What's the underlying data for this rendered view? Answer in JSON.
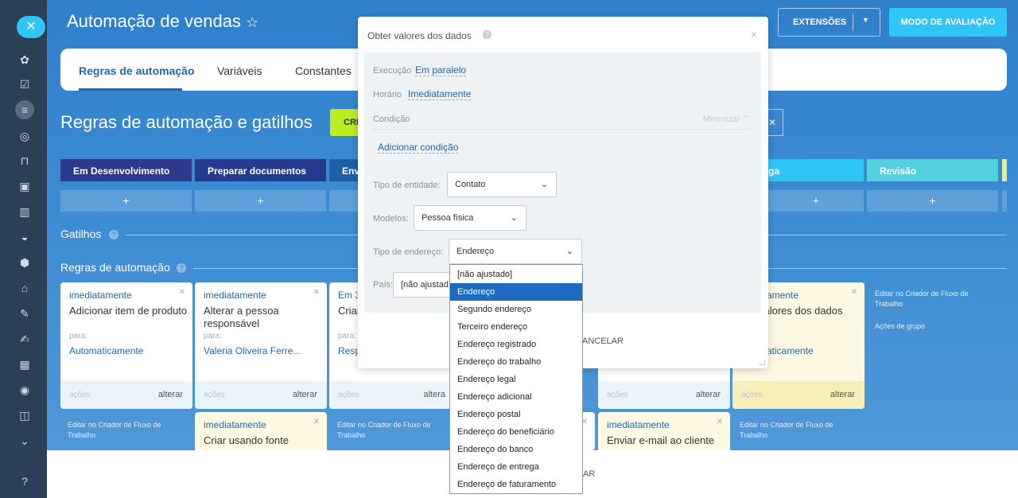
{
  "page": {
    "title": "Automação de vendas",
    "extensions_label": "EXTENSÕES",
    "mode_label": "MODO DE AVALIAÇÃO"
  },
  "tabs": [
    "Regras de automação",
    "Variáveis",
    "Constantes"
  ],
  "section_title": "Regras de automação e gatilhos",
  "create_label": "CRI",
  "stages": [
    {
      "label": "Em Desenvolvimento",
      "color": "#2c3a8c"
    },
    {
      "label": "Preparar documentos",
      "color": "#253b8e"
    },
    {
      "label": "Envi",
      "color": "#1d5fa8"
    },
    {
      "label": "ga",
      "color": "#2fc6f6"
    },
    {
      "label": "Revisão",
      "color": "#55d0e0"
    }
  ],
  "plus": "+",
  "rows": {
    "triggers": "Gatilhos",
    "rules": "Regras de automação"
  },
  "cards": [
    {
      "when": "imediatamente",
      "text": "Adicionar item de produto",
      "para": "para:",
      "value": "Automaticamente",
      "acoes": "ações",
      "alterar": "alterar"
    },
    {
      "when": "imediatamente",
      "text": "Alterar a pessoa responsável",
      "para": "para:",
      "value": "Valeria Oliveira Ferre...",
      "acoes": "ações",
      "alterar": "alterar"
    },
    {
      "when": "Em 3",
      "text": "Criar",
      "para": "para:",
      "value": "Resp",
      "acoes": "ações",
      "alterar": "altera"
    },
    {
      "when": "",
      "text": "",
      "para": "",
      "value": "",
      "acoes": "ações",
      "alterar": "alterar"
    },
    {
      "when": "atamente",
      "text": "valores dos dados",
      "para": "",
      "value": "maticamente",
      "acoes": "ações",
      "alterar": "alterar"
    }
  ],
  "cards2": [
    {
      "when": "imediatamente",
      "text": "Criar usando fonte"
    },
    {
      "when": "imediatamente",
      "text": "Enviar e-mail ao cliente"
    }
  ],
  "edit_link": "Editar no Criador de Fluxo de Trabalho",
  "group_actions": "Ações de grupo",
  "dialog": {
    "title": "Obter valores dos dados",
    "execution_label": "Execução",
    "execution_value": "Em paralelo",
    "time_label": "Horário",
    "time_value": "Imediatamente",
    "condition_label": "Condição",
    "minimize_label": "Minimizar",
    "add_condition": "Adicionar condição",
    "entity_type_label": "Tipo de entidade:",
    "entity_type_value": "Contato",
    "models_label": "Modelos:",
    "models_value": "Pessoa física",
    "address_type_label": "Tipo de endereço:",
    "address_type_value": "Endereço",
    "country_label": "País:",
    "country_value": "[não ajustad",
    "cancel_partial": "ANCELAR",
    "cancel_partial2": "AR"
  },
  "address_options": [
    "[não ajustado]",
    "Endereço",
    "Segundo endereço",
    "Terceiro endereço",
    "Endereço registrado",
    "Endereço do trabalho",
    "Endereço legal",
    "Endereço adicional",
    "Endereço postal",
    "Endereço do beneficiário",
    "Endereço do banco",
    "Endereço de entrega",
    "Endereço de faturamento"
  ],
  "selected_option_index": 1
}
